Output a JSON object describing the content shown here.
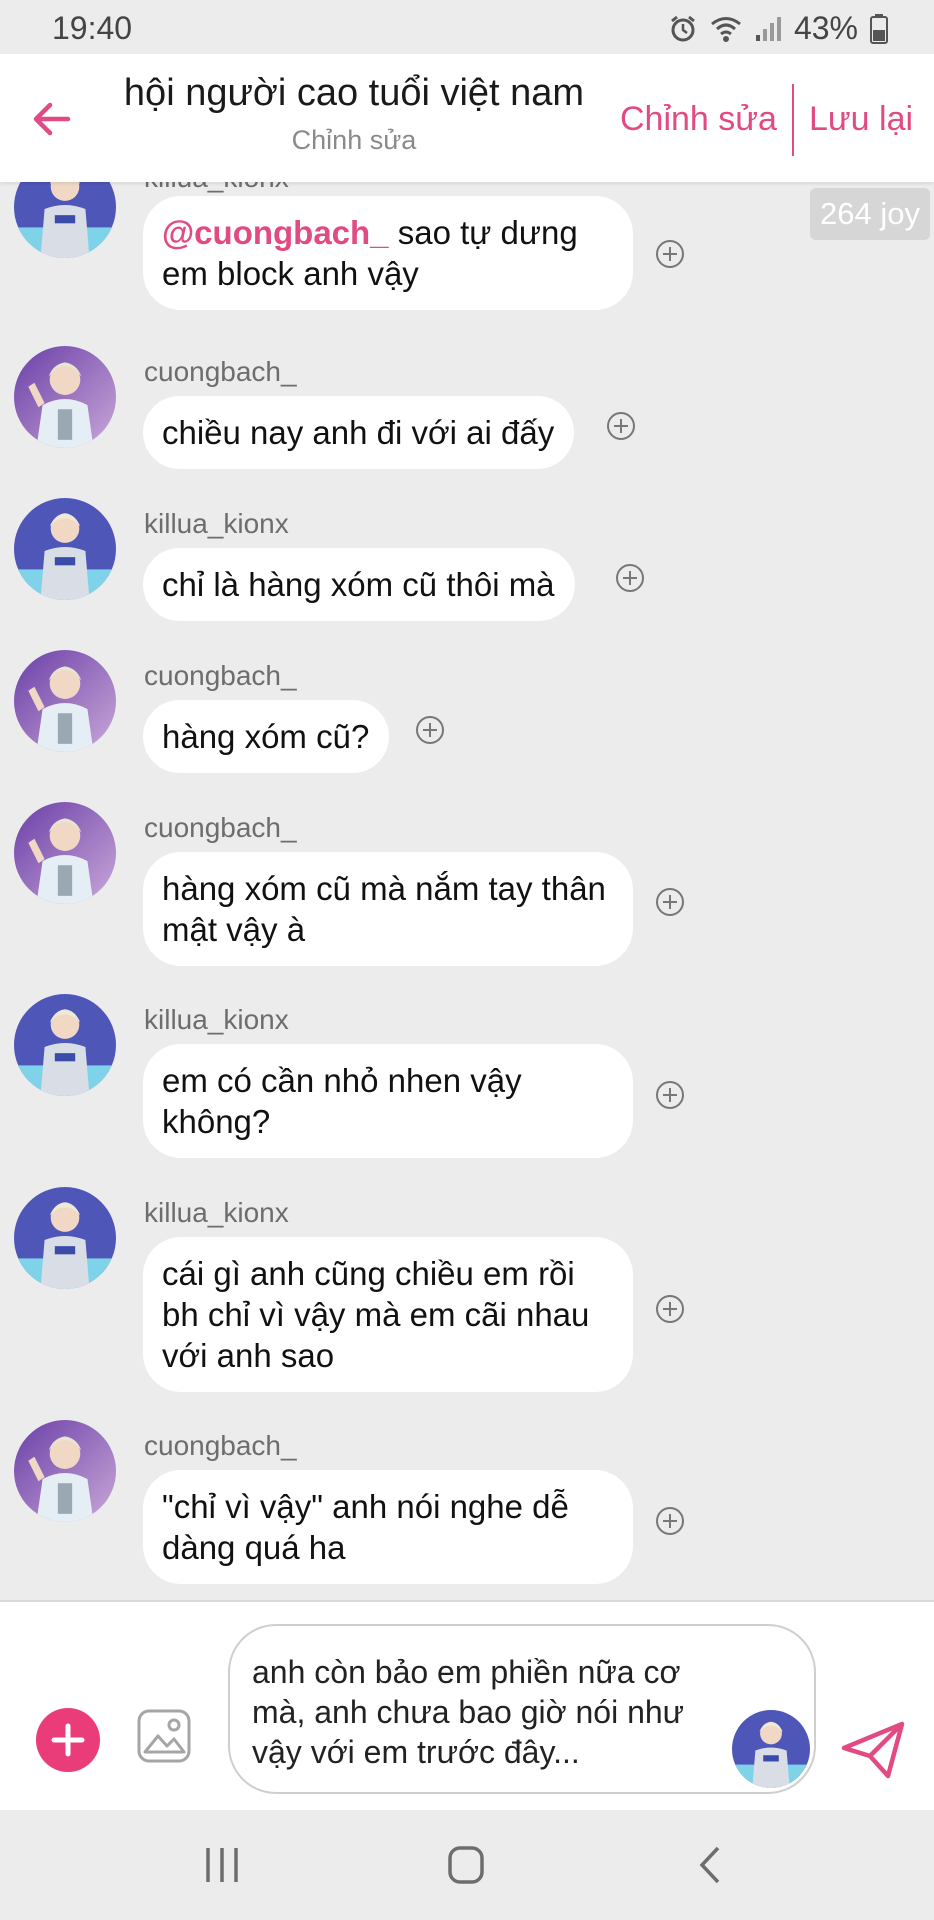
{
  "status_bar": {
    "time": "19:40",
    "battery": "43%"
  },
  "header": {
    "title": "hội người cao tuổi việt nam",
    "subtitle": "Chỉnh sửa",
    "edit_label": "Chỉnh sửa",
    "save_label": "Lưu lại",
    "accent_color": "#e14a82"
  },
  "joy_badge": "264 joy",
  "messages": [
    {
      "username": "killua_kionx",
      "mention": "@cuongbach_",
      "text": " sao tự dưng em block anh vậy"
    },
    {
      "username": "cuongbach_",
      "text": "chiều nay anh đi với ai đấy"
    },
    {
      "username": "killua_kionx",
      "text": "chỉ là hàng xóm cũ thôi mà"
    },
    {
      "username": "cuongbach_",
      "text": "hàng xóm cũ?"
    },
    {
      "username": "cuongbach_",
      "text": "hàng xóm cũ mà nắm tay thân mật vậy à"
    },
    {
      "username": "killua_kionx",
      "text": "em có cần nhỏ nhen vậy không?"
    },
    {
      "username": "killua_kionx",
      "text": "cái gì anh cũng chiều em rồi bh chỉ vì vậy mà em cãi nhau với anh sao"
    },
    {
      "username": "cuongbach_",
      "text": "\"chỉ vì vậy\" anh nói nghe dễ dàng quá ha"
    }
  ],
  "composer": {
    "input_value": "anh còn bảo em phiền nữa cơ mà, anh chưa bao giờ nói như vậy với em trước đây..."
  },
  "icons": {
    "back": "arrow-left-icon",
    "add": "plus-icon",
    "image": "image-icon",
    "send": "paper-plane-icon",
    "react": "plus-circle-icon",
    "nav_recents": "recents-icon",
    "nav_home": "home-icon",
    "nav_back": "chevron-left-icon"
  }
}
